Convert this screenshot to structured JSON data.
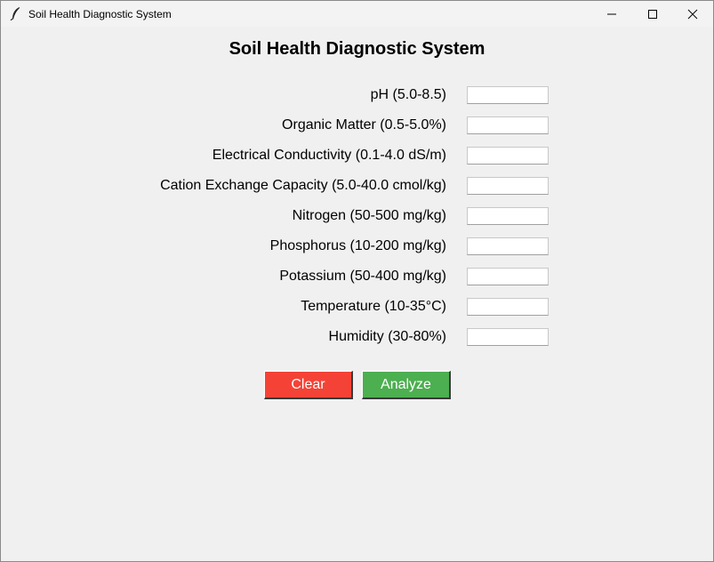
{
  "window": {
    "title": "Soil Health Diagnostic System",
    "icon": "feather-icon"
  },
  "main": {
    "heading": "Soil Health Diagnostic System",
    "fields": [
      {
        "label": "pH (5.0-8.5)",
        "value": ""
      },
      {
        "label": "Organic Matter (0.5-5.0%)",
        "value": ""
      },
      {
        "label": "Electrical Conductivity (0.1-4.0 dS/m)",
        "value": ""
      },
      {
        "label": "Cation Exchange Capacity (5.0-40.0 cmol/kg)",
        "value": ""
      },
      {
        "label": "Nitrogen (50-500 mg/kg)",
        "value": ""
      },
      {
        "label": "Phosphorus (10-200 mg/kg)",
        "value": ""
      },
      {
        "label": "Potassium (50-400 mg/kg)",
        "value": ""
      },
      {
        "label": "Temperature (10-35°C)",
        "value": ""
      },
      {
        "label": "Humidity (30-80%)",
        "value": ""
      }
    ],
    "buttons": {
      "clear_label": "Clear",
      "analyze_label": "Analyze"
    }
  },
  "colors": {
    "clear": "#f44336",
    "analyze": "#4caf50",
    "background": "#f0f0f0"
  }
}
